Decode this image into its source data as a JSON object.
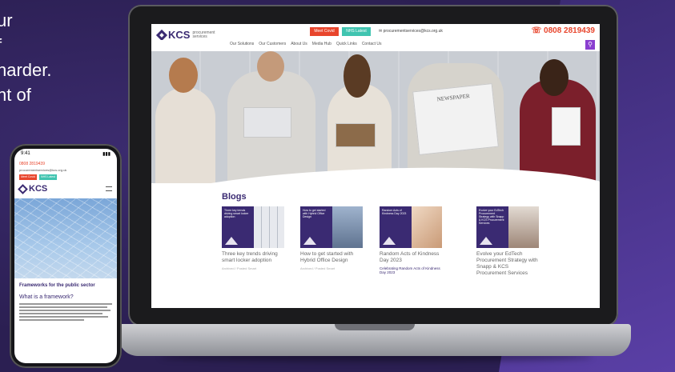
{
  "headline": {
    "lines": [
      "ur",
      "f",
      "harder.",
      "nt of"
    ]
  },
  "site": {
    "brand": "KCS",
    "brand_sub": "procurement services",
    "quote_button": "Meet Covid",
    "login_button": "NHS Latest",
    "email": "procurementservices@kcs.org.uk",
    "phone": "0808 2819439",
    "nav": [
      "Our Solutions",
      "Our Customers",
      "About Us",
      "Media Hub",
      "Quick Links",
      "Contact Us"
    ],
    "hero_newspaper": "NEWSPAPER"
  },
  "blogs": {
    "title": "Blogs",
    "cards": [
      {
        "overlay": "Three key trends driving smart locker adoption",
        "title": "Three key trends driving smart locker adoption",
        "meta": "Archived / Posted Smart",
        "photo": "#c9ced6"
      },
      {
        "overlay": "How to get started with Hybrid Office Design",
        "title": "How to get started with Hybrid Office Design",
        "meta": "Archived / Posted Smart",
        "photo": "#7d8fa8"
      },
      {
        "overlay": "Random Acts of Kindness Day 2023",
        "title": "Random Acts of Kindness Day 2023",
        "meta": "Celebrating Random Acts of Kindness Day 2023",
        "photo": "#d9b79a"
      },
      {
        "overlay": "Evolve your EdTech Procurement Strategy with Snapp & KCS Procurement Services",
        "title": "Evolve your EdTech Procurement Strategy with Snapp & KCS Procurement Services",
        "meta": "",
        "photo": "#b8a9a0"
      }
    ]
  },
  "phone": {
    "time": "9:41",
    "signal": "▮▮▮",
    "phone_number": "0808 2819439",
    "email": "procurementservices@kcs.org.uk",
    "btn_red": "Meet Covid",
    "btn_teal": "NHS Latest",
    "brand": "KCS",
    "section": "Frameworks for the public sector",
    "what": "What is a framework?"
  },
  "colors": {
    "brand": "#3a2a72",
    "accent_red": "#e8452c",
    "accent_teal": "#40c4b0",
    "search": "#8a3fd0"
  }
}
